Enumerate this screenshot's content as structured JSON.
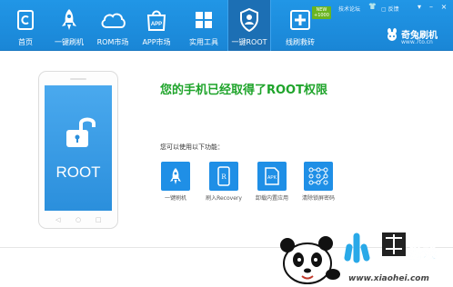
{
  "nav": {
    "items": [
      {
        "label": "首页",
        "icon": "home-icon"
      },
      {
        "label": "一键刷机",
        "icon": "rocket-icon"
      },
      {
        "label": "ROM市场",
        "icon": "cloud-icon"
      },
      {
        "label": "APP市场",
        "icon": "app-bag-icon"
      },
      {
        "label": "实用工具",
        "icon": "grid-icon"
      },
      {
        "label": "一键ROOT",
        "icon": "shield-icon"
      },
      {
        "label": "线刷救砖",
        "icon": "plus-box-icon"
      }
    ],
    "active": "一键ROOT",
    "new_badge": "NEW\n+1000"
  },
  "header_utils": {
    "forum": "技术论坛",
    "feedback": "反馈"
  },
  "brand": {
    "name": "奇兔刷机",
    "url": "www.7to.cn"
  },
  "phone": {
    "screen_text": "ROOT"
  },
  "main": {
    "headline": "您的手机已经取得了ROOT权限",
    "caption": "您可以使用以下功能：",
    "functions": [
      {
        "label": "一键刷机",
        "icon": "rocket-icon"
      },
      {
        "label": "刷入Recovery",
        "icon": "recovery-icon"
      },
      {
        "label": "卸载内置应用",
        "icon": "apk-icon"
      },
      {
        "label": "清除锁屏密码",
        "icon": "pattern-lock-icon"
      }
    ]
  },
  "watermark": {
    "brand": "小黑游戏",
    "url": "www.xiaohei.com"
  },
  "colors": {
    "header_blue": "#1a86d6",
    "accent_green": "#1fa42b",
    "tile_blue": "#1f8fe6"
  }
}
